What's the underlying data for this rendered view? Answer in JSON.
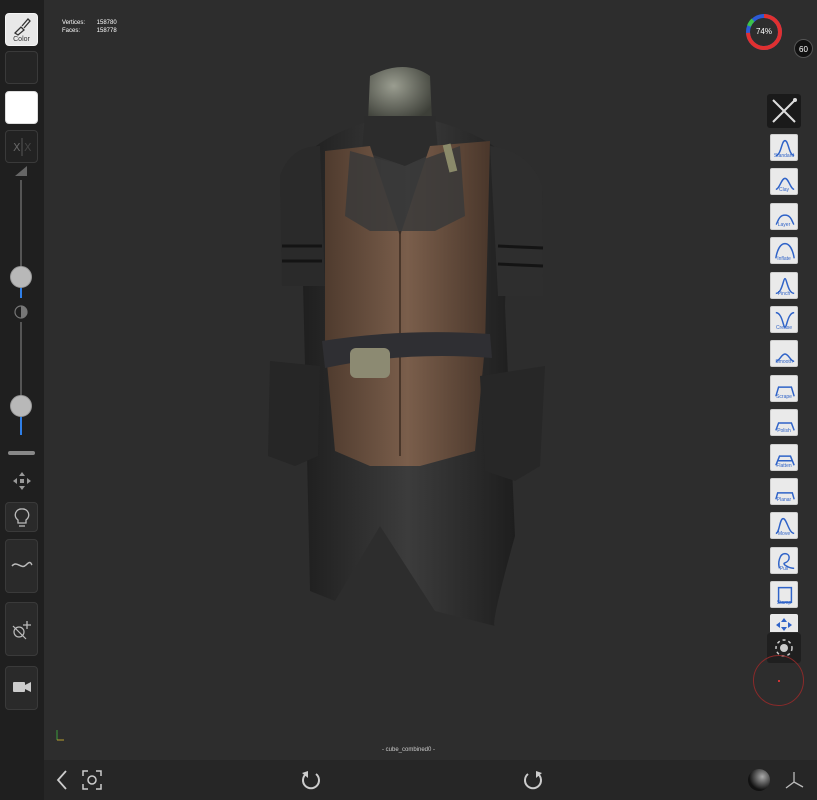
{
  "left_toolbar": {
    "color_label": "Color",
    "icons": {
      "color": "brush-color-icon",
      "symmetry": "symmetry-x-icon",
      "radius": "radius-triangle-icon",
      "intensity": "contrast-icon",
      "gizmo": "move-arrows-icon",
      "light": "lightbulb-icon",
      "stroke": "stroke-wave-icon",
      "mask": "mask-icon",
      "camera": "camera-icon"
    },
    "radius_slider": {
      "value": 0.18
    },
    "intensity_slider": {
      "value": 0.26
    }
  },
  "stats": {
    "vertices_label": "Vertices:",
    "vertices_value": "158780",
    "faces_label": "Faces:",
    "faces_value": "158778"
  },
  "memory": {
    "percent_text": "74%",
    "value": 0.74,
    "color": "#e03030"
  },
  "fps": "60",
  "mesh_name": "- cube_combined0 -",
  "brushes": [
    {
      "label": "Standard"
    },
    {
      "label": "Clay"
    },
    {
      "label": "Layer"
    },
    {
      "label": "Inflate"
    },
    {
      "label": "Pinch"
    },
    {
      "label": "Crease"
    },
    {
      "label": "Smooth"
    },
    {
      "label": "Scrape"
    },
    {
      "label": "Polish"
    },
    {
      "label": "Flatten"
    },
    {
      "label": "Planar"
    },
    {
      "label": "Move"
    },
    {
      "label": "Pull"
    },
    {
      "label": "Stamp"
    }
  ],
  "bottom_bar": {
    "icons": [
      "back-chevron-icon",
      "frame-view-icon",
      "undo-icon",
      "redo-icon",
      "matcap-sphere-icon",
      "axis-gizmo-icon"
    ]
  },
  "colors": {
    "accent": "#2f7fe8",
    "brush_label": "#2f63c8"
  }
}
